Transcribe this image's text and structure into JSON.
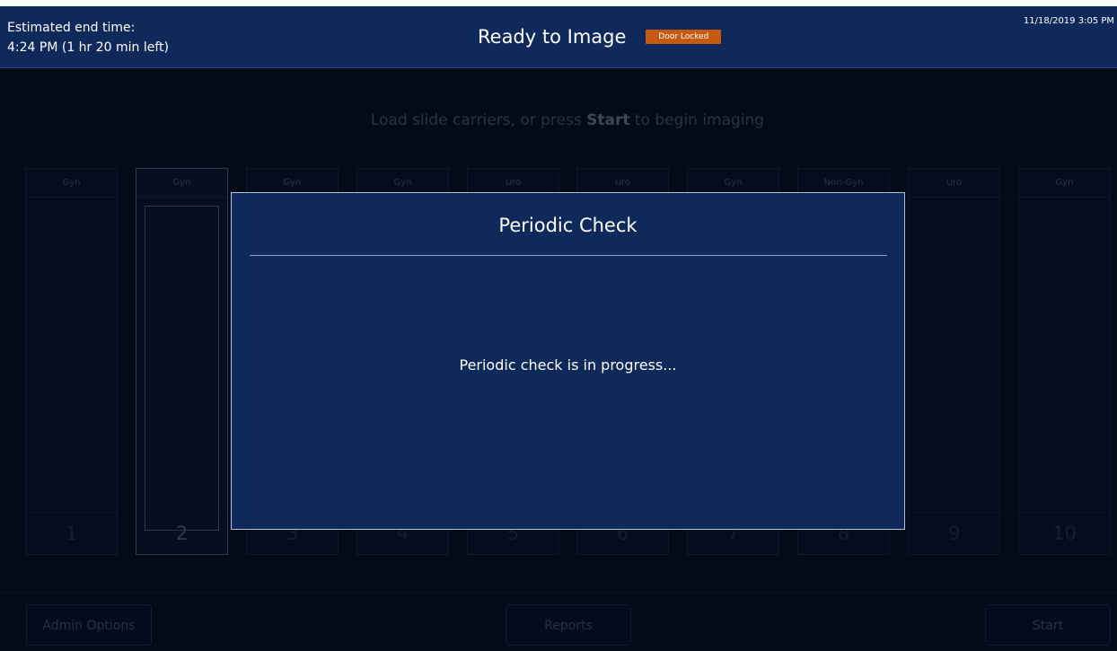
{
  "header": {
    "estimated_label": "Estimated end time:",
    "estimated_value": "4:24 PM (1 hr 20 min left)",
    "title": "Ready to Image",
    "badge": "Door Locked",
    "datetime": "11/18/2019 3:05 PM"
  },
  "instruction": {
    "before": "Load slide carriers, or press ",
    "bold": "Start",
    "after": " to begin imaging"
  },
  "bays": [
    {
      "label": "Gyn",
      "number": "1"
    },
    {
      "label": "Gyn",
      "number": "2",
      "selected": true
    },
    {
      "label": "Gyn",
      "number": "3"
    },
    {
      "label": "Gyn",
      "number": "4"
    },
    {
      "label": "Uro",
      "number": "5"
    },
    {
      "label": "Uro",
      "number": "6"
    },
    {
      "label": "Gyn",
      "number": "7"
    },
    {
      "label": "Non-Gyn",
      "number": "8"
    },
    {
      "label": "Uro",
      "number": "9"
    },
    {
      "label": "Gyn",
      "number": "10"
    }
  ],
  "footer": {
    "admin_label": "Admin Options",
    "reports_label": "Reports",
    "start_label": "Start"
  },
  "modal": {
    "title": "Periodic Check",
    "message": "Periodic check is in progress..."
  },
  "colors": {
    "header_bg": "#0f2a5a",
    "badge_bg": "#c75a10",
    "screen_bg": "#030a18"
  }
}
